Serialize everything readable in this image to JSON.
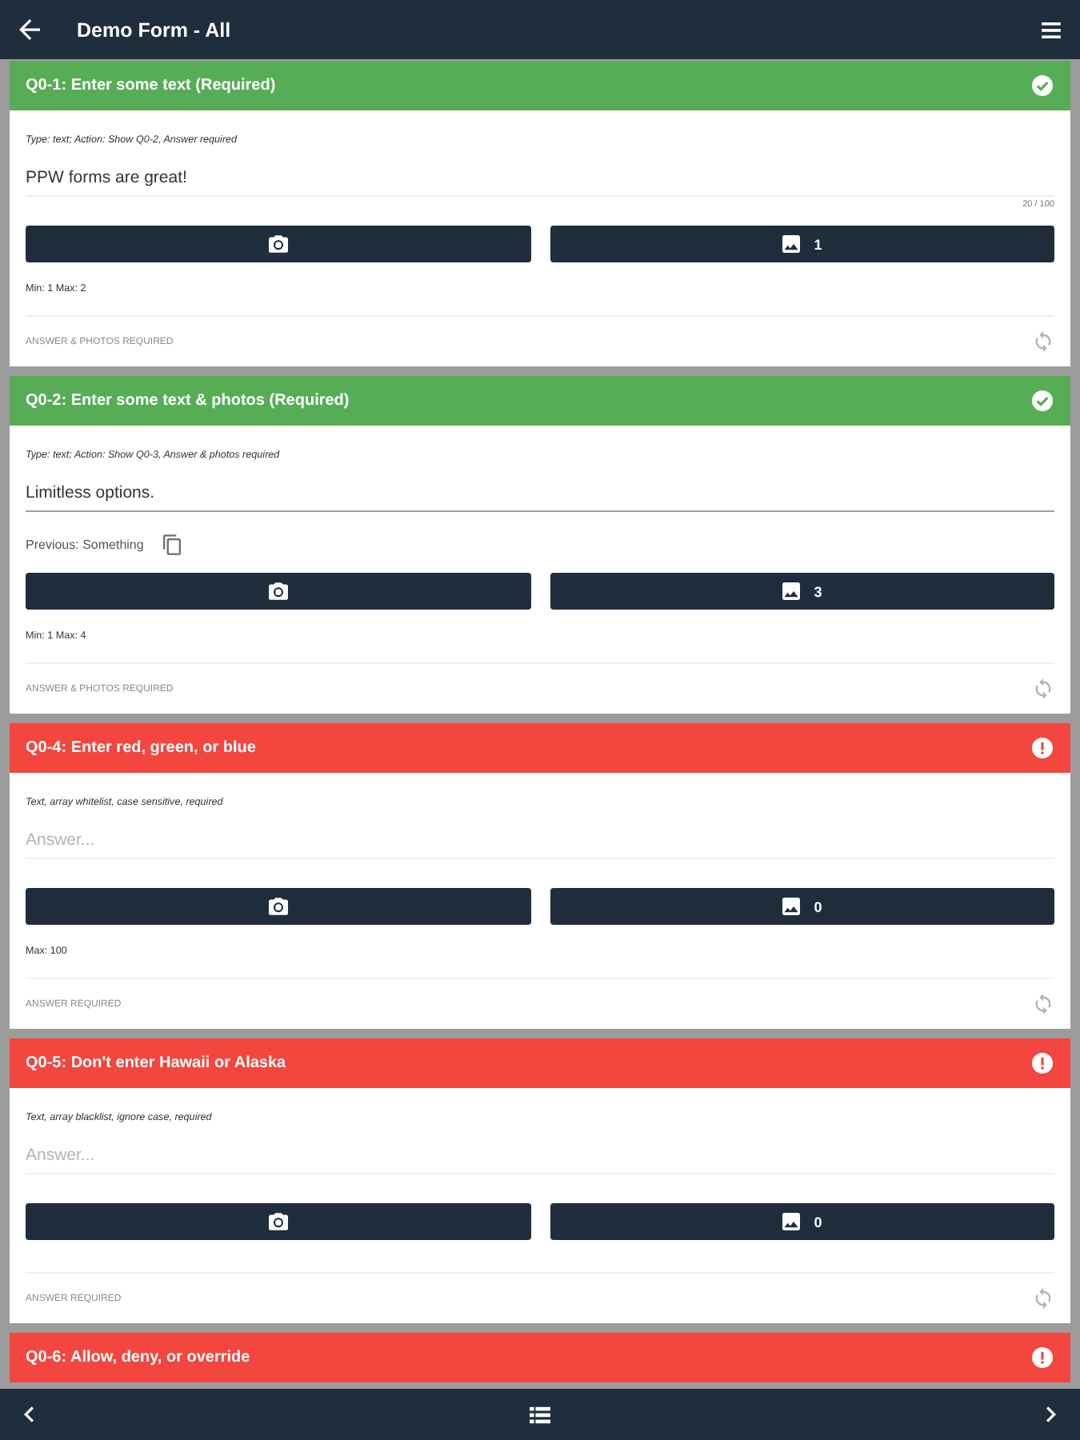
{
  "app_bar": {
    "title": "Demo Form - All"
  },
  "questions": [
    {
      "title": "Q0-1: Enter some text (Required)",
      "complete": true,
      "description": "Type: text; Action: Show Q0-2, Answer required",
      "answer": {
        "value": "PPW forms are great!",
        "focused": false
      },
      "counter": "20 / 100",
      "photo_count": "1",
      "limits": "Min: 1 Max: 2",
      "requirement": "ANSWER & PHOTOS REQUIRED"
    },
    {
      "title": "Q0-2: Enter some text & photos (Required)",
      "complete": true,
      "description": "Type: text; Action: Show Q0-3, Answer & photos required",
      "answer": {
        "value": "Limitless options.",
        "focused": true
      },
      "previous": "Previous: Something",
      "photo_count": "3",
      "limits": "Min: 1 Max: 4",
      "requirement": "ANSWER & PHOTOS REQUIRED"
    },
    {
      "title": "Q0-4: Enter red, green, or blue",
      "complete": false,
      "description": "Text, array whitelist, case sensitive, required",
      "answer": {
        "placeholder": "Answer...",
        "focused": false
      },
      "photo_count": "0",
      "limits": "Max: 100",
      "requirement": "ANSWER REQUIRED"
    },
    {
      "title": "Q0-5: Don't enter Hawaii or Alaska",
      "complete": false,
      "description": "Text, array blacklist, ignore case, required",
      "answer": {
        "placeholder": "Answer...",
        "focused": false
      },
      "photo_count": "0",
      "requirement": "ANSWER REQUIRED"
    },
    {
      "title": "Q0-6: Allow, deny, or override",
      "complete": false
    }
  ]
}
